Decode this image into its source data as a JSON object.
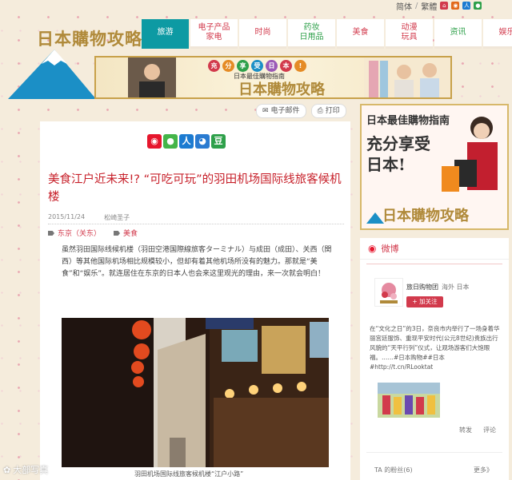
{
  "top_links": {
    "simplified": "简体",
    "sep": "/",
    "traditional": "繁體"
  },
  "logo_text": "日本購物攻略",
  "nav": [
    {
      "label": "旅游"
    },
    {
      "label": "电子产品\n家电"
    },
    {
      "label": "时尚"
    },
    {
      "label": "药妆\n日用品"
    },
    {
      "label": "美食"
    },
    {
      "label": "动漫\n玩具"
    },
    {
      "label": "资讯"
    },
    {
      "label": "娱乐"
    }
  ],
  "banner": {
    "bubbles": [
      "充",
      "分",
      "享",
      "受",
      "日",
      "本",
      "!"
    ],
    "tagline": "日本最佳購物指南",
    "logo": "日本購物攻略"
  },
  "toolbar": {
    "email": "电子邮件",
    "print": "打印"
  },
  "share_icons": [
    "weibo",
    "wechat",
    "renren",
    "qq",
    "douban"
  ],
  "share_glyphs": {
    "renren": "人",
    "douban": "豆"
  },
  "article": {
    "title": "美食江户近未来!? “可吃可玩”的羽田机场国际线旅客候机楼",
    "date": "2015/11/24",
    "author": "松崎圣子",
    "tags": [
      "东京（关东）",
      "美食"
    ],
    "body": "虽然羽田国际线候机楼（羽田空港国際線旅客ターミナル）与成田（成田）、关西（関西）等其他国际机场相比规模较小，但却有着其他机场所没有的魅力。那就是“美食”和“娱乐”。就连居住在东京的日本人也会来这里观光的理由，来一次就会明白！",
    "photo_caption": "羽田机场国际线旅客候机楼“江户小路”"
  },
  "ad": {
    "line1": "日本最佳購物指南",
    "line2": "充分享受",
    "line3": "日本!",
    "logo": "日本購物攻略"
  },
  "weibo": {
    "title": "微博",
    "name": "旅日购物团",
    "location": "海外 日本",
    "follow": "+ 加关注",
    "post": "在“文化之日”的3日，奈良市内举行了一场身着华丽宫廷服饰、重现平安时代(公元8世纪)贵族出行风貌的“天平行列”仪式，让观场游客们大饱眼福。……#日本购物##日本#http://t.cn/RLooktat",
    "repost": "转发",
    "comment": "评论",
    "fans": "TA 的粉丝(6)",
    "more": "更多》"
  },
  "watermark": "大部写真",
  "colors": {
    "accent": "#d23a4c",
    "teal": "#0d9aa3",
    "gold": "#b08a3a"
  }
}
